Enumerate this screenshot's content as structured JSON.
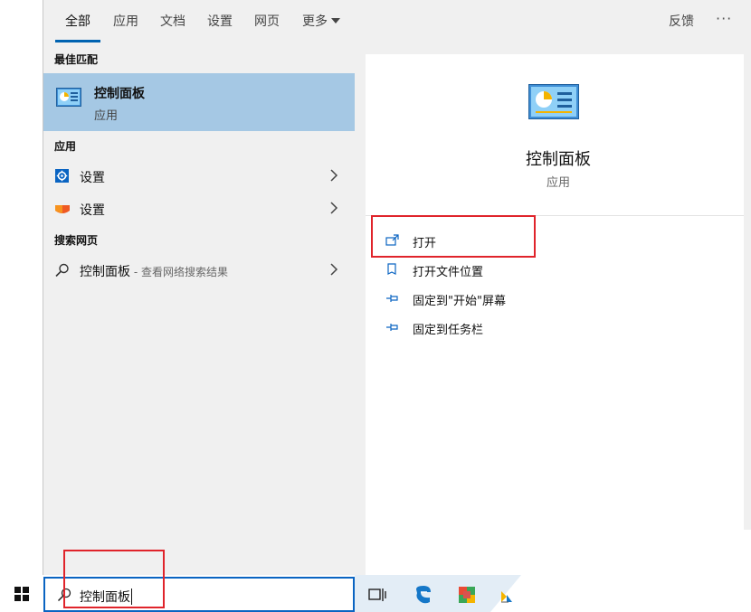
{
  "tabs": [
    {
      "label": "全部",
      "active": true
    },
    {
      "label": "应用"
    },
    {
      "label": "文档"
    },
    {
      "label": "设置"
    },
    {
      "label": "网页"
    },
    {
      "label": "更多"
    }
  ],
  "header": {
    "feedback_label": "反馈",
    "more_options": "···"
  },
  "results": {
    "best_match_heading": "最佳匹配",
    "best_match": {
      "title": "控制面板",
      "subtitle": "应用",
      "icon": "control-panel-icon"
    },
    "apps_heading": "应用",
    "apps": [
      {
        "label": "设置",
        "icon": "settings-gear-icon"
      },
      {
        "label": "设置",
        "icon": "settings-colorful-icon"
      }
    ],
    "web_heading": "搜索网页",
    "web": {
      "label": "控制面板",
      "hint": " - 查看网络搜索结果",
      "icon": "search-icon"
    }
  },
  "preview": {
    "title": "控制面板",
    "subtitle": "应用",
    "actions": [
      {
        "label": "打开",
        "icon": "open-icon"
      },
      {
        "label": "打开文件位置",
        "icon": "file-location-icon"
      },
      {
        "label": "固定到\"开始\"屏幕",
        "icon": "pin-icon"
      },
      {
        "label": "固定到任务栏",
        "icon": "pin-icon"
      }
    ]
  },
  "taskbar": {
    "search_value": "控制面板",
    "icons": [
      "windows-start-icon",
      "task-view-icon",
      "edge-icon",
      "store-icon",
      "app-icon"
    ]
  },
  "colors": {
    "accent": "#0063b1",
    "selected_bg": "#a5c8e4",
    "panel_bg": "#f0f0f0",
    "search_border": "#0a64c2",
    "highlight_box": "#e0242b"
  }
}
